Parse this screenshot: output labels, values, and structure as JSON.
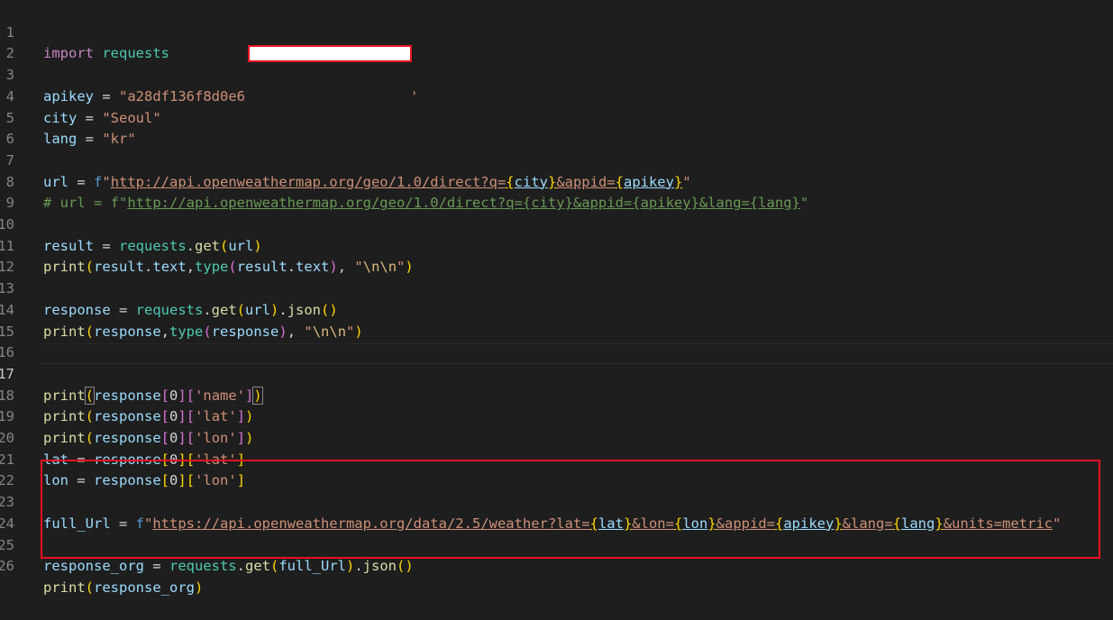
{
  "editor": {
    "language": "python",
    "active_line": "17",
    "colors": {
      "background": "#1e1e1e",
      "keyword": "#c586c0",
      "string": "#ce9178",
      "variable": "#9cdcfe",
      "function": "#dcdcaa",
      "comment": "#6a9955",
      "annotation_border": "#e81123"
    },
    "line_numbers": [
      "1",
      "2",
      "3",
      "4",
      "5",
      "6",
      "7",
      "8",
      "9",
      "10",
      "11",
      "12",
      "13",
      "14",
      "15",
      "16",
      "17",
      "18",
      "19",
      "20",
      "21",
      "22",
      "23",
      "24",
      "25",
      "26"
    ],
    "tokens": {
      "l1_import": "import",
      "l1_requests": "requests",
      "l3_var": "apikey",
      "l3_eq": " = ",
      "l3_str": "\"a28df136f8d0e6",
      "l3_tail": "'",
      "l4_var": "city",
      "l4_eq": " = ",
      "l4_str": "\"Seoul\"",
      "l5_var": "lang",
      "l5_eq": " = ",
      "l5_str": "\"kr\"",
      "l7_var": "url",
      "l7_eq": " = ",
      "l7_f": "f",
      "l7_q1": "\"",
      "l7_link": "http://api.openweathermap.org/geo/1.0/direct?q=",
      "l7_b1": "{",
      "l7_city": "city",
      "l7_b2": "}",
      "l7_mid": "&appid=",
      "l7_b3": "{",
      "l7_apikey": "apikey",
      "l7_b4": "}",
      "l7_q2": "\"",
      "l8_comment_pre": "# url = f\"",
      "l8_comment_link": "http://api.openweathermap.org/geo/1.0/direct?q={city}&appid={apikey}&lang={lang}",
      "l8_comment_post": "\"",
      "l10_var": "result",
      "l10_eq": " = ",
      "l10_mod": "requests",
      "l10_dot": ".",
      "l10_fn": "get",
      "l10_p1": "(",
      "l10_arg": "url",
      "l10_p2": ")",
      "l11_fn": "print",
      "l11_p1": "(",
      "l11_a": "result",
      "l11_dot": ".",
      "l11_attr": "text",
      "l11_comma": ",",
      "l11_type": "type",
      "l11_p2": "(",
      "l11_b": "result",
      "l11_dot2": ".",
      "l11_attr2": "text",
      "l11_p3": ")",
      "l11_comma2": ", ",
      "l11_str_a": "\"",
      "l11_esc": "\\n\\n",
      "l11_str_b": "\"",
      "l11_p4": ")",
      "l13_var": "response",
      "l13_eq": " = ",
      "l13_mod": "requests",
      "l13_dot": ".",
      "l13_fn": "get",
      "l13_p1": "(",
      "l13_arg": "url",
      "l13_p2": ")",
      "l13_dot2": ".",
      "l13_json": "json",
      "l13_p3": "()",
      "l14_fn": "print",
      "l14_p1": "(",
      "l14_a": "response",
      "l14_comma": ",",
      "l14_type": "type",
      "l14_p2": "(",
      "l14_b": "response",
      "l14_p3": ")",
      "l14_comma2": ", ",
      "l14_str_a": "\"",
      "l14_esc": "\\n\\n",
      "l14_str_b": "\"",
      "l14_p4": ")",
      "l17_fn": "print",
      "l17_p1": "(",
      "l17_a": "response",
      "l17_b1": "[",
      "l17_idx": "0",
      "l17_b2": "]",
      "l17_b3": "[",
      "l17_key": "'name'",
      "l17_b4": "]",
      "l17_p2": ")",
      "l18_fn": "print",
      "l18_p1": "(",
      "l18_a": "response",
      "l18_b1": "[",
      "l18_idx": "0",
      "l18_b2": "]",
      "l18_b3": "[",
      "l18_key": "'lat'",
      "l18_b4": "]",
      "l18_p2": ")",
      "l19_fn": "print",
      "l19_p1": "(",
      "l19_a": "response",
      "l19_b1": "[",
      "l19_idx": "0",
      "l19_b2": "]",
      "l19_b3": "[",
      "l19_key": "'lon'",
      "l19_b4": "]",
      "l19_p2": ")",
      "l20_var": "lat",
      "l20_eq": " = ",
      "l20_a": "response",
      "l20_b1": "[",
      "l20_idx": "0",
      "l20_b2": "]",
      "l20_b3": "[",
      "l20_key": "'lat'",
      "l20_b4": "]",
      "l21_var": "lon",
      "l21_eq": " = ",
      "l21_a": "response",
      "l21_b1": "[",
      "l21_idx": "0",
      "l21_b2": "]",
      "l21_b3": "[",
      "l21_key": "'lon'",
      "l21_b4": "]",
      "l23_var": "full_Url",
      "l23_eq": " = ",
      "l23_f": "f",
      "l23_q1": "\"",
      "l23_link1": "https://api.openweathermap.org/data/2.5/weather?lat=",
      "l23_br1": "{",
      "l23_lat": "lat",
      "l23_br2": "}",
      "l23_link2": "&lon=",
      "l23_br3": "{",
      "l23_lon": "lon",
      "l23_br4": "}",
      "l23_link3": "&appid=",
      "l23_br5": "{",
      "l23_apikey": "apikey",
      "l23_br6": "}",
      "l23_link4": "&lang=",
      "l23_br7": "{",
      "l23_lang": "lang",
      "l23_br8": "}",
      "l23_link5": "&units=metric",
      "l23_q2": "\"",
      "l25_var": "response_org",
      "l25_eq": " = ",
      "l25_mod": "requests",
      "l25_dot": ".",
      "l25_fn": "get",
      "l25_p1": "(",
      "l25_arg": "full_Url",
      "l25_p2": ")",
      "l25_dot2": ".",
      "l25_json": "json",
      "l25_p3": "()",
      "l26_fn": "print",
      "l26_p1": "(",
      "l26_arg": "response_org",
      "l26_p2": ")"
    }
  }
}
